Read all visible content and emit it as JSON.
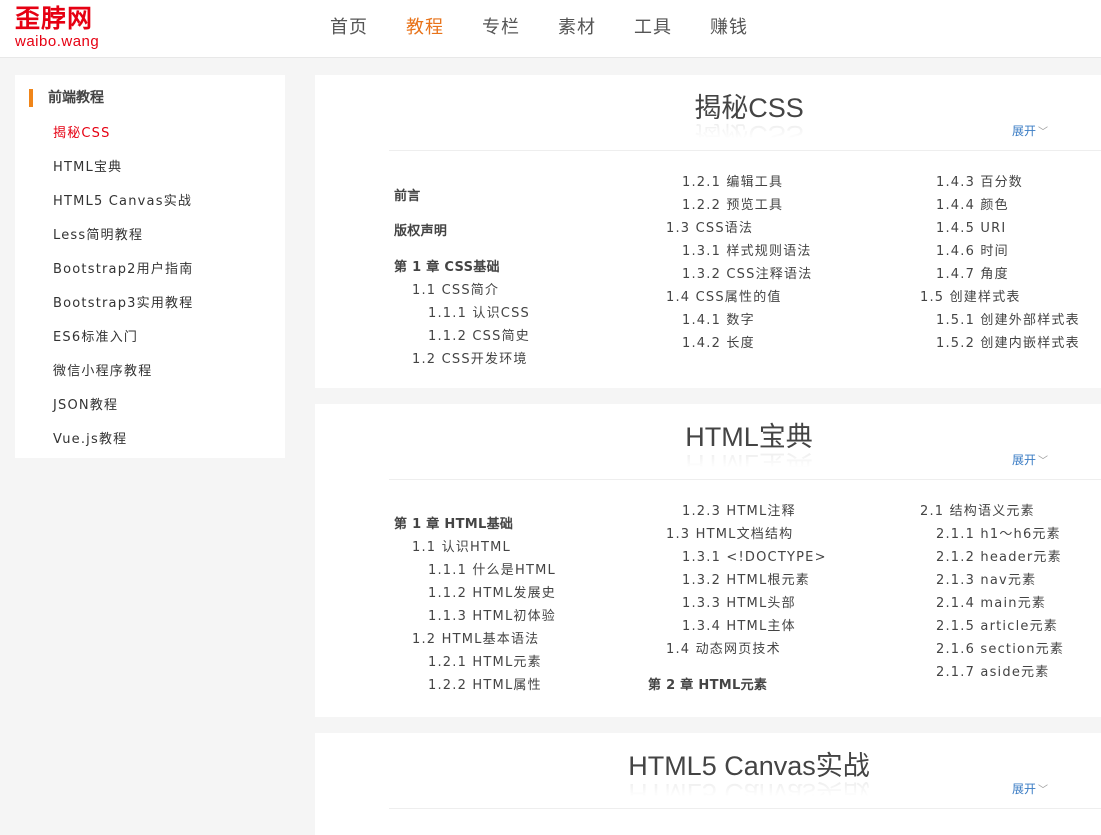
{
  "logo": {
    "cn": "歪脖网",
    "en": "waibo.wang"
  },
  "nav": [
    "首页",
    "教程",
    "专栏",
    "素材",
    "工具",
    "赚钱"
  ],
  "sidebar": {
    "title": "前端教程",
    "items": [
      "揭秘CSS",
      "HTML宝典",
      "HTML5 Canvas实战",
      "Less简明教程",
      "Bootstrap2用户指南",
      "Bootstrap3实用教程",
      "ES6标准入门",
      "微信小程序教程",
      "JSON教程",
      "Vue.js教程"
    ]
  },
  "cards": [
    {
      "title": "揭秘CSS",
      "expand": "展开",
      "columns": [
        [
          "前言",
          "版权声明",
          "第 1 章 CSS基础",
          "1.1 CSS简介",
          "1.1.1 认识CSS",
          "1.1.2 CSS简史",
          "1.2 CSS开发环境"
        ],
        [
          "1.2.1 编辑工具",
          "1.2.2 预览工具",
          "1.3 CSS语法",
          "1.3.1 样式规则语法",
          "1.3.2 CSS注释语法",
          "1.4 CSS属性的值",
          "1.4.1 数字",
          "1.4.2 长度"
        ],
        [
          "1.4.3 百分数",
          "1.4.4 颜色",
          "1.4.5 URI",
          "1.4.6 时间",
          "1.4.7 角度",
          "1.5 创建样式表",
          "1.5.1 创建外部样式表",
          "1.5.2 创建内嵌样式表"
        ]
      ]
    },
    {
      "title": "HTML宝典",
      "expand": "展开",
      "columns": [
        [
          "第 1 章 HTML基础",
          "1.1 认识HTML",
          "1.1.1 什么是HTML",
          "1.1.2 HTML发展史",
          "1.1.3 HTML初体验",
          "1.2 HTML基本语法",
          "1.2.1 HTML元素",
          "1.2.2 HTML属性"
        ],
        [
          "1.2.3 HTML注释",
          "1.3 HTML文档结构",
          "1.3.1 <!DOCTYPE>",
          "1.3.2 HTML根元素",
          "1.3.3 HTML头部",
          "1.3.4 HTML主体",
          "1.4 动态网页技术",
          "第 2 章 HTML元素"
        ],
        [
          "2.1 结构语义元素",
          "2.1.1 h1～h6元素",
          "2.1.2 header元素",
          "2.1.3 nav元素",
          "2.1.4 main元素",
          "2.1.5 article元素",
          "2.1.6 section元素",
          "2.1.7 aside元素"
        ]
      ]
    },
    {
      "title": "HTML5 Canvas实战",
      "expand": "展开"
    }
  ]
}
